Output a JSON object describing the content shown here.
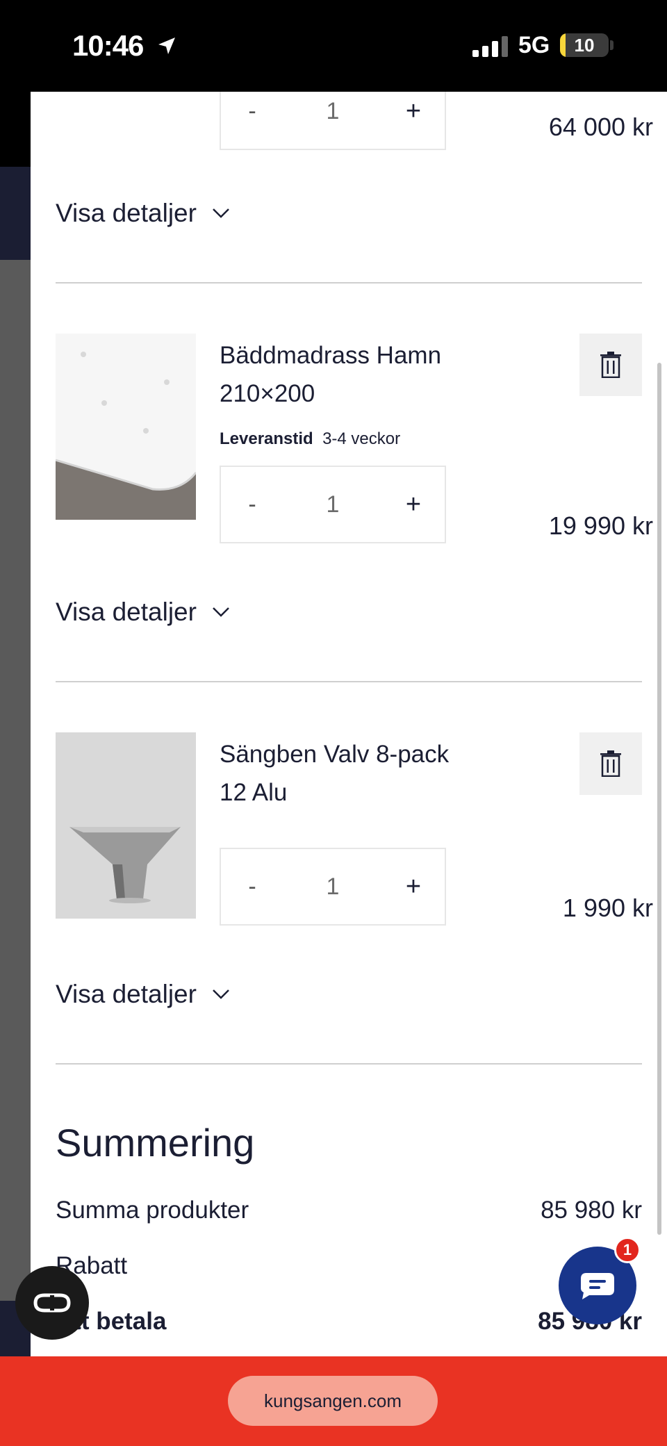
{
  "status_bar": {
    "time": "10:46",
    "network": "5G",
    "battery": "10"
  },
  "cart": {
    "details_label": "Visa detaljer",
    "items": [
      {
        "quantity": "1",
        "price": "64 000 kr"
      },
      {
        "name": "Bäddmadrass Hamn 210×200",
        "lead_label": "Leveranstid",
        "lead_value": "3-4 veckor",
        "quantity": "1",
        "price": "19 990 kr"
      },
      {
        "name": "Sängben Valv 8-pack 12 Alu",
        "quantity": "1",
        "price": "1 990 kr"
      }
    ],
    "qty_minus": "-",
    "qty_plus": "+"
  },
  "summary": {
    "title": "Summering",
    "products_label": "Summa produkter",
    "products_value": "85 980 kr",
    "discount_label": "Rabatt",
    "total_label": "Att betala",
    "total_value": "85 980 kr"
  },
  "chat": {
    "badge": "1"
  },
  "browser": {
    "url": "kungsangen.com"
  },
  "icons": {
    "location": "location-arrow-icon",
    "signal": "cellular-signal-icon",
    "battery": "battery-icon",
    "trash": "trash-icon",
    "chevron": "chevron-down-icon",
    "chat": "chat-bubble-icon",
    "glasses": "glasses-icon"
  }
}
